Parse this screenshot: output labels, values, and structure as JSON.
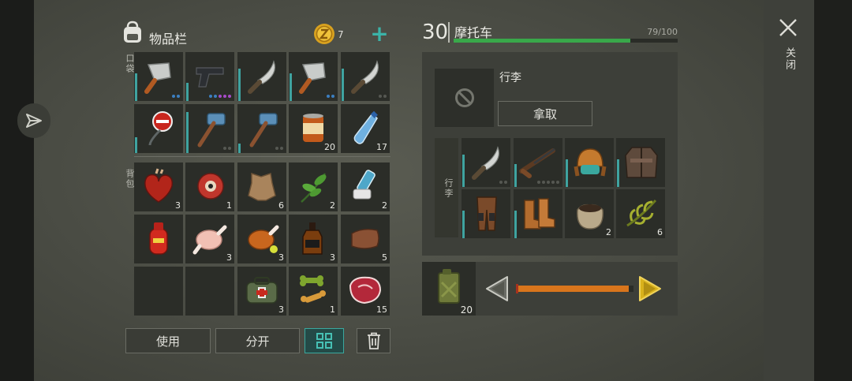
{
  "inventory": {
    "title": "物品栏",
    "coins": "7",
    "add_label": "+",
    "pocket_label": "口袋",
    "backpack_label": "背包",
    "pocket": [
      {
        "icon": "cleaver-icon",
        "count": "",
        "dots": [
          "#3c7fc1",
          "#3c7fc1"
        ],
        "dura": 0.6
      },
      {
        "icon": "pistol-icon",
        "count": "",
        "dots": [
          "#3c7fc1",
          "#3c7fc1",
          "#a64bc8",
          "#a64bc8",
          "#a64bc8"
        ],
        "dura": 0.4
      },
      {
        "icon": "machete-icon",
        "count": "",
        "dots": [],
        "dura": 0.7
      },
      {
        "icon": "cleaver-icon",
        "count": "",
        "dots": [
          "#3c7fc1",
          "#3c7fc1"
        ],
        "dura": 0.6
      },
      {
        "icon": "machete-icon",
        "count": "",
        "dots": [
          "#555852",
          "#555852"
        ],
        "dura": 0.7
      },
      {
        "icon": "stop-sign-icon",
        "count": "",
        "dots": [],
        "dura": 0.35
      },
      {
        "icon": "sledgehammer-icon",
        "count": "",
        "dots": [
          "#555852",
          "#555852"
        ],
        "dura": 0.9
      },
      {
        "icon": "sledgehammer-icon",
        "count": "",
        "dots": [
          "#555852",
          "#555852"
        ],
        "dura": 0.2
      },
      {
        "icon": "canned-food-icon",
        "count": "20",
        "dots": [],
        "dura": 0
      },
      {
        "icon": "water-bottle-icon",
        "count": "17",
        "dots": [],
        "dura": 0
      }
    ],
    "backpack": [
      {
        "icon": "heart-icon",
        "count": "3"
      },
      {
        "icon": "eyeball-icon",
        "count": "1"
      },
      {
        "icon": "leather-hide-icon",
        "count": "6"
      },
      {
        "icon": "herb-icon",
        "count": "2"
      },
      {
        "icon": "inhaler-icon",
        "count": "2"
      },
      {
        "icon": "gas-canister-icon",
        "count": ""
      },
      {
        "icon": "raw-chicken-icon",
        "count": "3"
      },
      {
        "icon": "roast-chicken-icon",
        "count": "3"
      },
      {
        "icon": "whiskey-icon",
        "count": "3"
      },
      {
        "icon": "leather-icon",
        "count": "5"
      },
      {
        "icon": "",
        "count": ""
      },
      {
        "icon": "",
        "count": ""
      },
      {
        "icon": "medkit-bag-icon",
        "count": "3"
      },
      {
        "icon": "dog-bone-icon",
        "count": "1"
      },
      {
        "icon": "raw-steak-icon",
        "count": "15"
      }
    ],
    "buttons": {
      "use": "使用",
      "split": "分开"
    }
  },
  "vehicle": {
    "level": "30",
    "name": "摩托车",
    "durability_text": "79/100",
    "durability": 0.79,
    "slot_title": "行李",
    "take_label": "拿取",
    "side_label": "行李",
    "items": [
      {
        "icon": "machete-icon",
        "count": "",
        "dots": [
          "#555852",
          "#555852"
        ],
        "dura": 0.7
      },
      {
        "icon": "shotgun-icon",
        "count": "",
        "dots": [
          "#555852",
          "#555852",
          "#555852",
          "#555852",
          "#555852"
        ],
        "dura": 0.5
      },
      {
        "icon": "aviator-cap-icon",
        "count": "",
        "dots": [],
        "dura": 0.6
      },
      {
        "icon": "jacket-icon",
        "count": "",
        "dots": [],
        "dura": 0.6
      },
      {
        "icon": "pants-icon",
        "count": "",
        "dots": [],
        "dura": 0.6
      },
      {
        "icon": "boots-icon",
        "count": "",
        "dots": [],
        "dura": 0.6
      },
      {
        "icon": "seed-sack-icon",
        "count": "2",
        "dots": [],
        "dura": 0
      },
      {
        "icon": "plant-fiber-icon",
        "count": "6",
        "dots": [],
        "dura": 0
      }
    ],
    "fuel_count": "20",
    "fuel_level": 0.96
  },
  "close_label": "关闭"
}
